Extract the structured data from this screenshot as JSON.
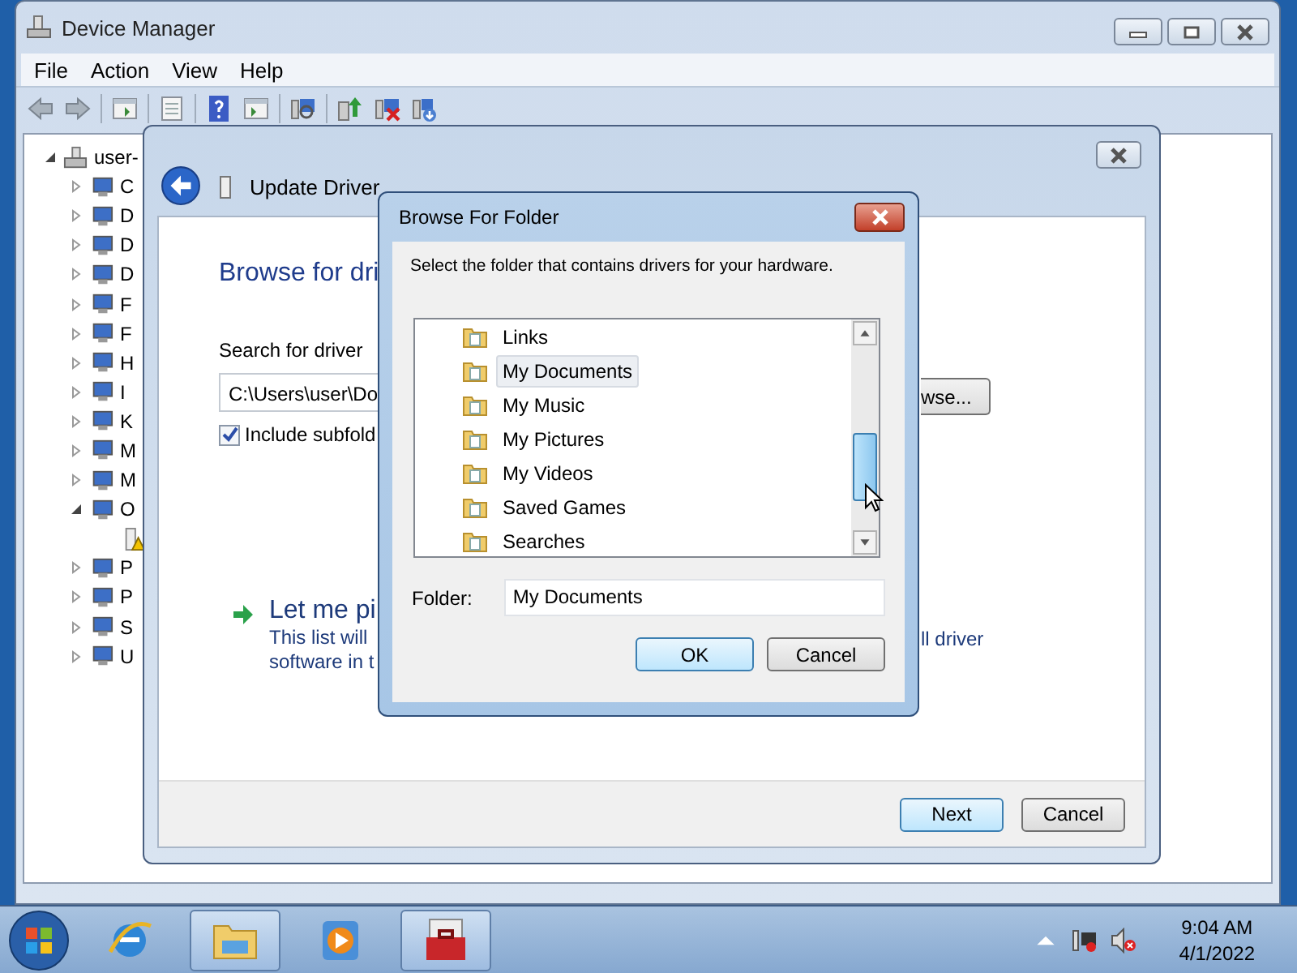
{
  "device_manager": {
    "title": "Device Manager",
    "menu": [
      "File",
      "Action",
      "View",
      "Help"
    ],
    "tree": {
      "label": "user-",
      "expanded": true,
      "children": [
        {
          "label": "C",
          "expanded": false
        },
        {
          "label": "D",
          "expanded": false
        },
        {
          "label": "D",
          "expanded": false
        },
        {
          "label": "D",
          "expanded": false
        },
        {
          "label": "F",
          "expanded": false
        },
        {
          "label": "F",
          "expanded": false
        },
        {
          "label": "H",
          "expanded": false
        },
        {
          "label": "I",
          "expanded": false
        },
        {
          "label": "K",
          "expanded": false
        },
        {
          "label": "M",
          "expanded": false
        },
        {
          "label": "M",
          "expanded": false
        },
        {
          "label": "O",
          "expanded": true,
          "children": [
            {
              "kind": "warning-device"
            }
          ]
        },
        {
          "label": "P",
          "expanded": false
        },
        {
          "label": "P",
          "expanded": false
        },
        {
          "label": "S",
          "expanded": false
        },
        {
          "label": "U",
          "expanded": false
        }
      ]
    }
  },
  "wizard": {
    "header": "Update Driver",
    "heading": "Browse for dri",
    "search_label": "Search for driver",
    "path": "C:\\Users\\user\\Do",
    "browse_button": "wse...",
    "include_subfolders": {
      "label": "Include subfold",
      "checked": true
    },
    "pick_title": "Let me pi",
    "pick_description": [
      "This list will",
      "software in t"
    ],
    "pick_description_right": "ll driver",
    "buttons": [
      {
        "label": "Next",
        "default": true
      },
      {
        "label": "Cancel",
        "default": false
      }
    ]
  },
  "browse_dialog": {
    "title": "Browse For Folder",
    "instruction": "Select the folder that contains drivers for your hardware.",
    "folders": [
      {
        "label": "Links",
        "selected": false
      },
      {
        "label": "My Documents",
        "selected": true
      },
      {
        "label": "My Music",
        "selected": false
      },
      {
        "label": "My Pictures",
        "selected": false
      },
      {
        "label": "My Videos",
        "selected": false
      },
      {
        "label": "Saved Games",
        "selected": false
      },
      {
        "label": "Searches",
        "selected": false
      }
    ],
    "folder_label": "Folder:",
    "folder_value": "My Documents",
    "buttons": [
      {
        "label": "OK",
        "default": true
      },
      {
        "label": "Cancel",
        "default": false
      }
    ]
  },
  "taskbar": {
    "items": [
      {
        "kind": "browser",
        "open": false
      },
      {
        "kind": "folder",
        "open": true
      },
      {
        "kind": "media",
        "open": false
      },
      {
        "kind": "toolbox",
        "open": true
      }
    ],
    "time": "9:04 AM",
    "date": "4/1/2022"
  }
}
